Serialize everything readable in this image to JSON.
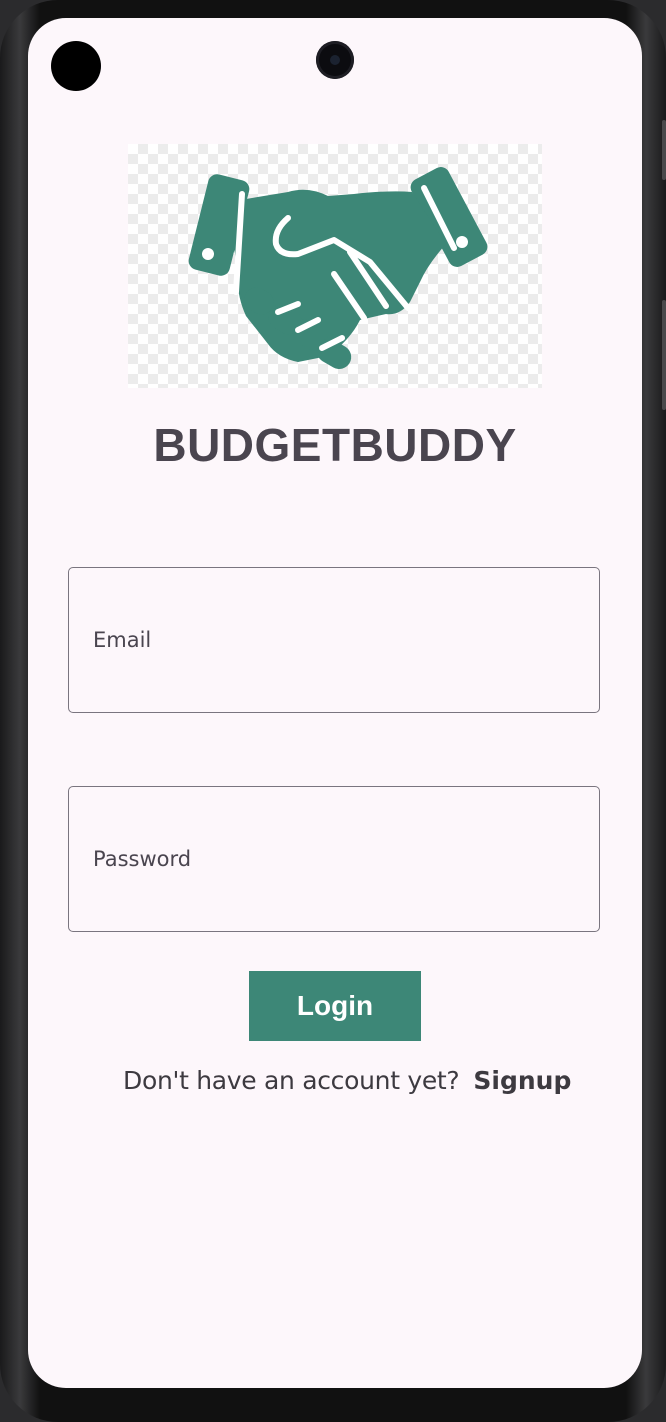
{
  "app": {
    "title": "BUDGETBUDDY"
  },
  "logo": {
    "icon": "handshake-icon",
    "color": "#3d8777"
  },
  "form": {
    "email_label": "Email",
    "password_label": "Password",
    "login_label": "Login"
  },
  "signup": {
    "prompt": "Don't have an account yet?",
    "link_label": "Signup"
  },
  "colors": {
    "accent": "#3d8777",
    "background": "#fdf7fb",
    "text": "#4a454f"
  }
}
